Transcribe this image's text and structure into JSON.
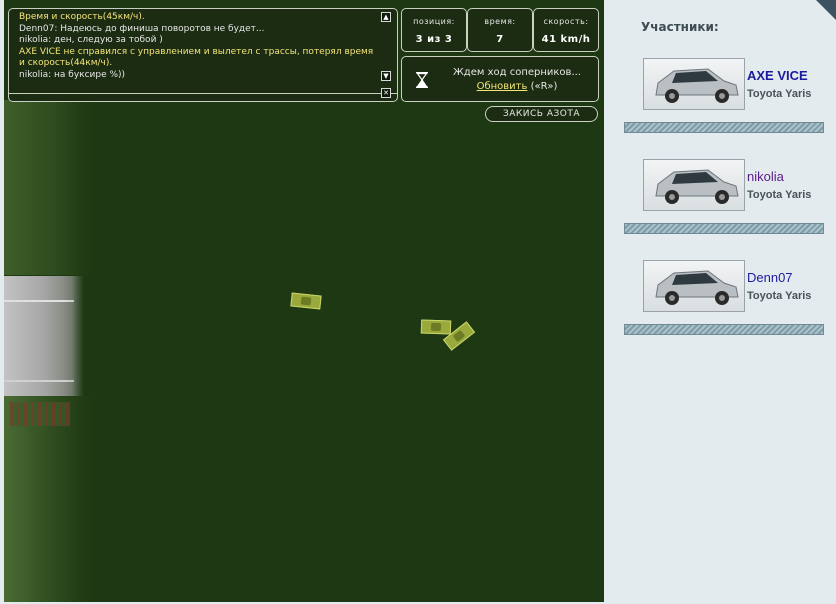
{
  "chat": {
    "lines": [
      {
        "text": "Время и скорость(45км/ч).",
        "highlight": true
      },
      {
        "text": "Denn07: Надеюсь до финиша поворотов не будет...",
        "highlight": false
      },
      {
        "text": "nikolia: ден, следую за тобой )",
        "highlight": false
      },
      {
        "text": "AXE VICE не справился с управлением и вылетел с трассы, потерял время и скорость(44км/ч).",
        "highlight": true
      },
      {
        "text": "nikolia: на буксире %))",
        "highlight": false
      }
    ]
  },
  "stats": {
    "position_label": "позиция:",
    "position_value": "3 из 3",
    "time_label": "время:",
    "time_value": "7",
    "speed_label": "скорость:",
    "speed_value": "41 km/h"
  },
  "wait": {
    "text": "Ждем ход соперников...",
    "refresh_label": "Обновить",
    "refresh_hotkey": "(«R»)"
  },
  "nitro_label": "ЗАКИСЬ АЗОТА",
  "sidebar": {
    "title": "Участники:",
    "participants": [
      {
        "name": "AXE VICE",
        "car": "Toyota Yaris",
        "color": "#1a1a9e"
      },
      {
        "name": "nikolia",
        "car": "Toyota Yaris",
        "color": "#5a1a8a"
      },
      {
        "name": "Denn07",
        "car": "Toyota Yaris",
        "color": "#1a1a9e"
      }
    ]
  },
  "colors": {
    "track": "#1d3812",
    "chat_highlight": "#f4e478",
    "panel_bg": "#1c2c12"
  }
}
